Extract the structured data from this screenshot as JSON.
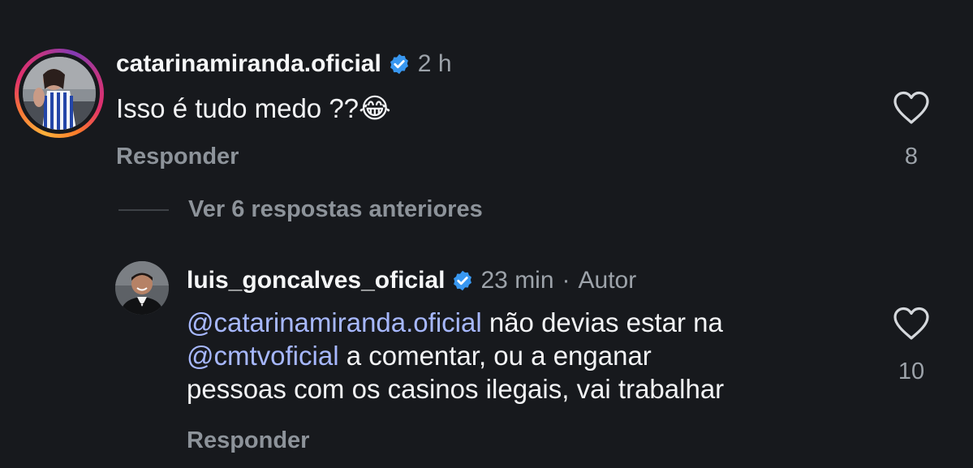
{
  "comment": {
    "username": "catarinamiranda.oficial",
    "time": "2 h",
    "text_main": "Isso é tudo medo ??",
    "emoji": "😂",
    "reply_label": "Responder",
    "like_count": "8"
  },
  "view_more": "Ver 6 respostas anteriores",
  "reply": {
    "username": "luis_goncalves_oficial",
    "time": "23 min",
    "separator": "·",
    "author_label": "Autor",
    "mention1": "@catarinamiranda.oficial",
    "text1": " não devias estar na",
    "mention2": "@cmtvoficial",
    "text2": " a comentar, ou a enganar",
    "text3": "pessoas com os casinos ilegais, vai trabalhar",
    "reply_label": "Responder",
    "like_count": "10"
  },
  "colors": {
    "background": "#17191d",
    "verified": "#3897f0",
    "mention": "#a7b8ff"
  }
}
